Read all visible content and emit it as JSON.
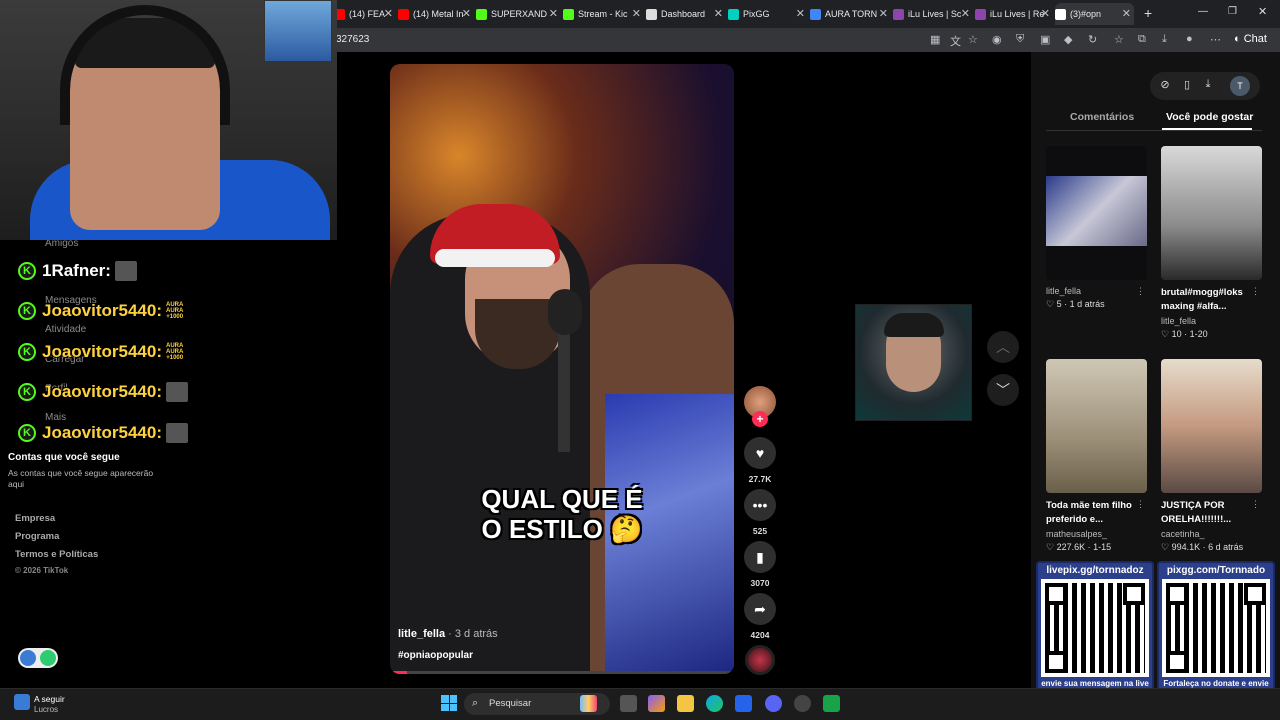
{
  "browser": {
    "tabs": [
      {
        "label": "(14) FEA",
        "color": "#ff0000"
      },
      {
        "label": "(14) Metal In",
        "color": "#ff0000"
      },
      {
        "label": "SUPERXAND",
        "color": "#53fc18"
      },
      {
        "label": "Stream - Kic",
        "color": "#53fc18"
      },
      {
        "label": "Dashboard",
        "color": "#dddddd"
      },
      {
        "label": "PixGG",
        "color": "#00d1c1"
      },
      {
        "label": "AURA TORN",
        "color": "#4285f4"
      },
      {
        "label": "iLu Lives | Sc",
        "color": "#8e44ad"
      },
      {
        "label": "iLu Lives | Re",
        "color": "#8e44ad"
      },
      {
        "label": "(3)#opn",
        "color": "#ffffff"
      }
    ],
    "url": "327623",
    "new_tab": "+",
    "chat_label": "Chat"
  },
  "sidebar": {
    "nav_ghost": [
      "Amigos",
      "Mensagens",
      "Atividade",
      "Carregar",
      "Perfil",
      "Mais"
    ],
    "chat": [
      {
        "name": "1Rafner:",
        "style": "white"
      },
      {
        "name": "Joaovitor5440:",
        "aura": "AURA\nAURA\n+1000"
      },
      {
        "name": "Joaovitor5440:",
        "aura": "AURA\nAURA\n+1000"
      },
      {
        "name": "Joaovitor5440:"
      },
      {
        "name": "Joaovitor5440:"
      }
    ],
    "kick_letter": "K",
    "following_title": "Contas que você segue",
    "following_desc": "As contas que você segue aparecerão aqui",
    "footer": [
      "Empresa",
      "Programa",
      "Termos e Políticas"
    ],
    "copyright": "© 2026 TikTok"
  },
  "video": {
    "caption_line1": "QUAL QUE É",
    "caption_line2": "O ESTILO 🤔",
    "author": "litle_fella",
    "author_time": "· 3 d atrás",
    "hashtag": "#opniaopopular",
    "progress": 0.05
  },
  "actions": {
    "likes": "27.7K",
    "comments": "525",
    "saves": "3070",
    "shares": "4204",
    "follow_plus": "+"
  },
  "right_panel": {
    "tabs": [
      "Comentários",
      "Você pode gostar"
    ],
    "active_tab": "Você pode gostar",
    "me_initial": "T",
    "cards": [
      {
        "title": "",
        "user": "litle_fella",
        "meta": "♡ 5 · 1 d atrás"
      },
      {
        "title": "brutal#mogg#loks maxing #alfa...",
        "user": "litle_fella",
        "meta": "♡ 10 · 1-20"
      },
      {
        "title": "Toda mãe tem filho preferido e...",
        "user": "matheusalpes_",
        "meta": "♡ 227.6K · 1-15"
      },
      {
        "title": "JUSTIÇA POR ORELHA!!!!!!!...",
        "user": "cacetinha_",
        "meta": "♡ 994.1K · 6 d atrás"
      }
    ]
  },
  "pix": [
    {
      "title": "livepix.gg/tornnadoz",
      "footer": "envie sua mensagem na live via pix!"
    },
    {
      "title": "pixgg.com/Tornnado",
      "footer": "Fortaleça no donate e envie sua mensagem!"
    }
  ],
  "taskbar": {
    "weather_title": "A seguir",
    "weather_sub": "Lucros",
    "search_placeholder": "Pesquisar"
  }
}
